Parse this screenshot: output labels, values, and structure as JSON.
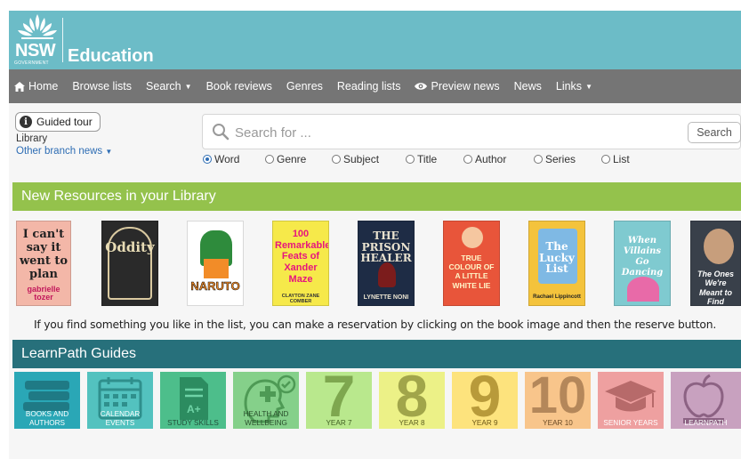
{
  "header": {
    "logo_primary": "NSW",
    "logo_secondary": "GOVERNMENT",
    "title": "Education",
    "brand_color": "#6cbcc7"
  },
  "nav": {
    "items": [
      {
        "label": "Home",
        "icon": "home-icon"
      },
      {
        "label": "Browse lists"
      },
      {
        "label": "Search",
        "dropdown": true
      },
      {
        "label": "Book reviews"
      },
      {
        "label": "Genres"
      },
      {
        "label": "Reading lists"
      },
      {
        "label": "Preview news",
        "icon": "eye-icon"
      },
      {
        "label": "News"
      },
      {
        "label": "Links",
        "dropdown": true
      }
    ]
  },
  "sidebar": {
    "tour_label": "Guided tour",
    "library_label": "Library",
    "branch_label": "Other branch news"
  },
  "search": {
    "placeholder": "Search for ...",
    "value": "",
    "button_label": "Search",
    "options": [
      {
        "label": "Word",
        "selected": true
      },
      {
        "label": "Genre",
        "selected": false
      },
      {
        "label": "Subject",
        "selected": false
      },
      {
        "label": "Title",
        "selected": false
      },
      {
        "label": "Author",
        "selected": false
      },
      {
        "label": "Series",
        "selected": false
      },
      {
        "label": "List",
        "selected": false
      }
    ]
  },
  "new_resources": {
    "heading": "New Resources in your Library",
    "books": [
      {
        "title": "I can't say it went to plan",
        "author": "gabrielle tozer",
        "bg": "#f3b7a8"
      },
      {
        "title": "Oddity",
        "author": "",
        "bg": "#2a2a2a"
      },
      {
        "title": "NARUTO",
        "author": "",
        "bg": "#ffffff"
      },
      {
        "title": "100 Remarkable Feats of Xander Maze",
        "author": "CLAYTON ZANE COMBER",
        "bg": "#f6e94a"
      },
      {
        "title": "THE PRISON HEALER",
        "author": "LYNETTE NONI",
        "bg": "#1e2c45"
      },
      {
        "title": "TRUE COLOUR OF A LITTLE WHITE LIE",
        "author": "",
        "bg": "#e8553a"
      },
      {
        "title": "The Lucky List",
        "author": "Rachael Lippincott",
        "bg": "#f4c33c"
      },
      {
        "title": "When Villains Go Dancing",
        "author": "",
        "bg": "#7fcad0"
      },
      {
        "title": "The Ones We're Meant to Find",
        "author": "",
        "bg": "#39404a"
      }
    ],
    "hint": "If you find something you like in the list, you can make a reservation by clicking on the book image and then the reserve button."
  },
  "learnpath": {
    "heading": "LearnPath Guides",
    "tiles": [
      {
        "label": "BOOKS AND AUTHORS",
        "icon": "books-icon",
        "color": "#2aa7b6"
      },
      {
        "label": "CALENDAR EVENTS",
        "icon": "calendar-icon",
        "color": "#53c2bf"
      },
      {
        "label": "STUDY SKILLS",
        "icon": "document-icon",
        "color": "#4dbe8b"
      },
      {
        "label": "HEALTH AND WELLBEING",
        "icon": "health-icon",
        "color": "#85d08a"
      },
      {
        "label": "YEAR 7",
        "big": "7",
        "color": "#b9e88d"
      },
      {
        "label": "YEAR 8",
        "big": "8",
        "color": "#ecf187"
      },
      {
        "label": "YEAR 9",
        "big": "9",
        "color": "#fde37d"
      },
      {
        "label": "YEAR 10",
        "big": "10",
        "color": "#f8c58b"
      },
      {
        "label": "SENIOR YEARS",
        "icon": "graduation-cap-icon",
        "color": "#eea0a0"
      },
      {
        "label": "LEARNPATH",
        "icon": "apple-icon",
        "color": "#c8a1bf"
      }
    ]
  }
}
